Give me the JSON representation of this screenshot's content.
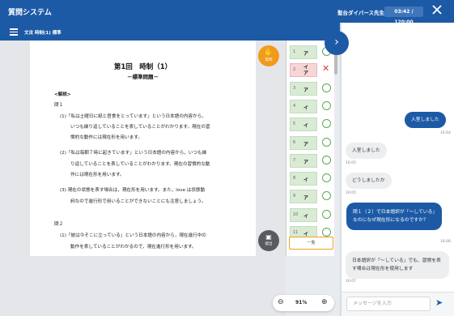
{
  "header": {
    "app_title": "質問システム",
    "teacher": "聖台ダイバース先生",
    "timer": "03:42 / 120:00"
  },
  "subheader": {
    "title": "文法 時制(1) 標準"
  },
  "document": {
    "title": "第1回　時制（1）",
    "subtitle": "－標準問題－",
    "section": "<解説>",
    "lines": [
      "問１",
      "(1)「私は土曜日に紙と昼食をとっています」という日本語の内容から，",
      "いつも繰り返していることを表していることがわかります。現在の習",
      "慣的な動作には現在形を用います。",
      "(2)「私は毎朝７時に起きています」という日本語の内容から，いつも繰",
      "り返していることを表していることがわかります。現在の習慣的な動",
      "作には現在形を用います。",
      "(3) 現在の状態を表す場合は，現在形を用います。また，love は状態動",
      "詞なので進行形で用いることができないことにも注意しましょう。",
      "問２",
      "(1)「彼は今そこに立っている」という日本語の内容から，現在進行中の",
      "動作を表していることがわかるので，現在進行形を用います。"
    ]
  },
  "side_buttons": {
    "raise_hand": "質問",
    "submit": "提出"
  },
  "answers": [
    {
      "num": "1",
      "value": "ア",
      "status": "correct"
    },
    {
      "num": "2",
      "value": "イ\nア",
      "status": "wrong"
    },
    {
      "num": "3",
      "value": "ア",
      "status": "correct"
    },
    {
      "num": "4",
      "value": "イ",
      "status": "correct"
    },
    {
      "num": "5",
      "value": "イ",
      "status": "correct"
    },
    {
      "num": "6",
      "value": "ア",
      "status": "correct"
    },
    {
      "num": "7",
      "value": "ア",
      "status": "correct"
    },
    {
      "num": "8",
      "value": "イ",
      "status": "correct"
    },
    {
      "num": "9",
      "value": "ア",
      "status": "correct"
    },
    {
      "num": "10",
      "value": "イ",
      "status": "correct"
    },
    {
      "num": "11",
      "value": "イ",
      "status": "correct"
    }
  ],
  "answers_all_label": "一覧",
  "zoom": {
    "value": "91%"
  },
  "chat": {
    "messages": [
      {
        "from": "me",
        "text": "入室しました",
        "time": "16:04"
      },
      {
        "from": "them",
        "text": "入室しました",
        "time": "16:05"
      },
      {
        "from": "them",
        "text": "どうしましたか",
        "time": "16:05"
      },
      {
        "from": "me",
        "text": "問１（２）で日本語訳が「～している」なのになぜ現在形になるのですか？",
        "time": "16:06"
      },
      {
        "from": "them",
        "text": "日本語訳が「～している」でも、習慣を表す場合は現在形を使用します",
        "time": "16:07"
      }
    ],
    "input_placeholder": "メッセージを入力"
  }
}
